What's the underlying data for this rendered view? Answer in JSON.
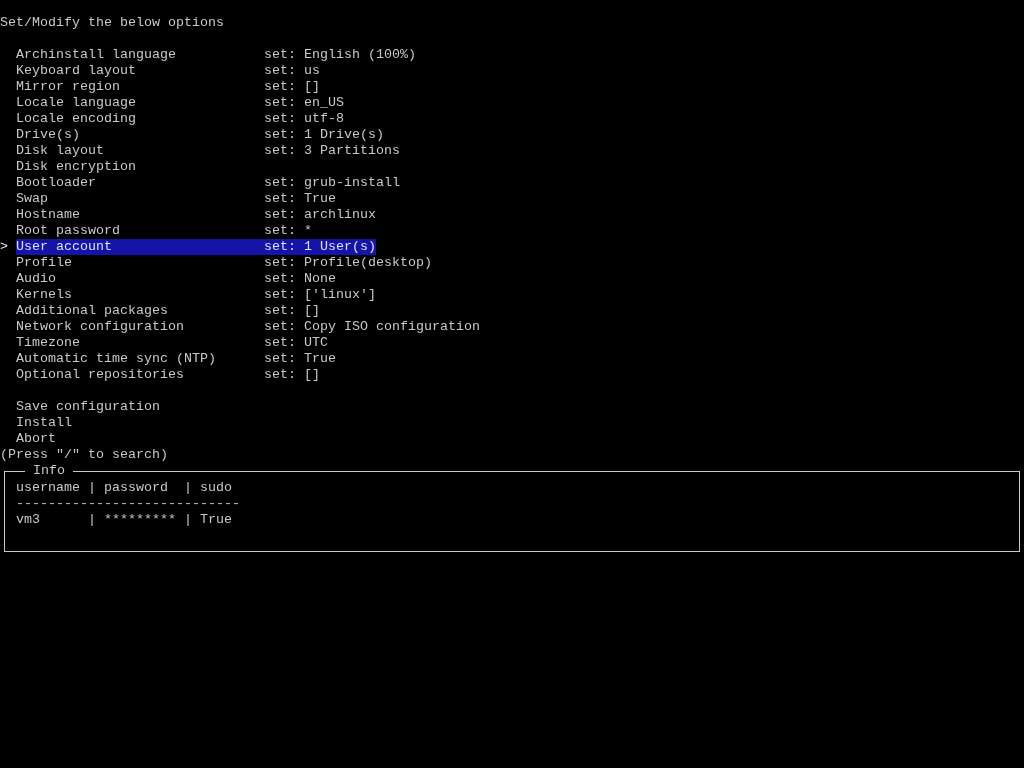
{
  "heading": "Set/Modify the below options",
  "cursor": ">",
  "options": [
    {
      "label": "Archinstall language",
      "value": "set: English (100%)",
      "selected": false
    },
    {
      "label": "Keyboard layout",
      "value": "set: us",
      "selected": false
    },
    {
      "label": "Mirror region",
      "value": "set: []",
      "selected": false
    },
    {
      "label": "Locale language",
      "value": "set: en_US",
      "selected": false
    },
    {
      "label": "Locale encoding",
      "value": "set: utf-8",
      "selected": false
    },
    {
      "label": "Drive(s)",
      "value": "set: 1 Drive(s)",
      "selected": false
    },
    {
      "label": "Disk layout",
      "value": "set: 3 Partitions",
      "selected": false
    },
    {
      "label": "Disk encryption",
      "selected": false
    },
    {
      "label": "Bootloader",
      "value": "set: grub-install",
      "selected": false
    },
    {
      "label": "Swap",
      "value": "set: True",
      "selected": false
    },
    {
      "label": "Hostname",
      "value": "set: archlinux",
      "selected": false
    },
    {
      "label": "Root password",
      "value": "set: *",
      "selected": false
    },
    {
      "label": "User account",
      "value": "set: 1 User(s)",
      "selected": true
    },
    {
      "label": "Profile",
      "value": "set: Profile(desktop)",
      "selected": false
    },
    {
      "label": "Audio",
      "value": "set: None",
      "selected": false
    },
    {
      "label": "Kernels",
      "value": "set: ['linux']",
      "selected": false
    },
    {
      "label": "Additional packages",
      "value": "set: []",
      "selected": false
    },
    {
      "label": "Network configuration",
      "value": "set: Copy ISO configuration",
      "selected": false
    },
    {
      "label": "Timezone",
      "value": "set: UTC",
      "selected": false
    },
    {
      "label": "Automatic time sync (NTP)",
      "value": "set: True",
      "selected": false
    },
    {
      "label": "Optional repositories",
      "value": "set: []",
      "selected": false
    }
  ],
  "actions": [
    {
      "label": "Save configuration",
      "selected": false
    },
    {
      "label": "Install",
      "selected": false
    },
    {
      "label": "Abort",
      "selected": false
    }
  ],
  "search_hint": "(Press \"/\" to search)",
  "info": {
    "title": "Info",
    "header": "username | password  | sudo",
    "separator": "----------------------------",
    "rows": [
      "vm3      | ********* | True"
    ]
  }
}
